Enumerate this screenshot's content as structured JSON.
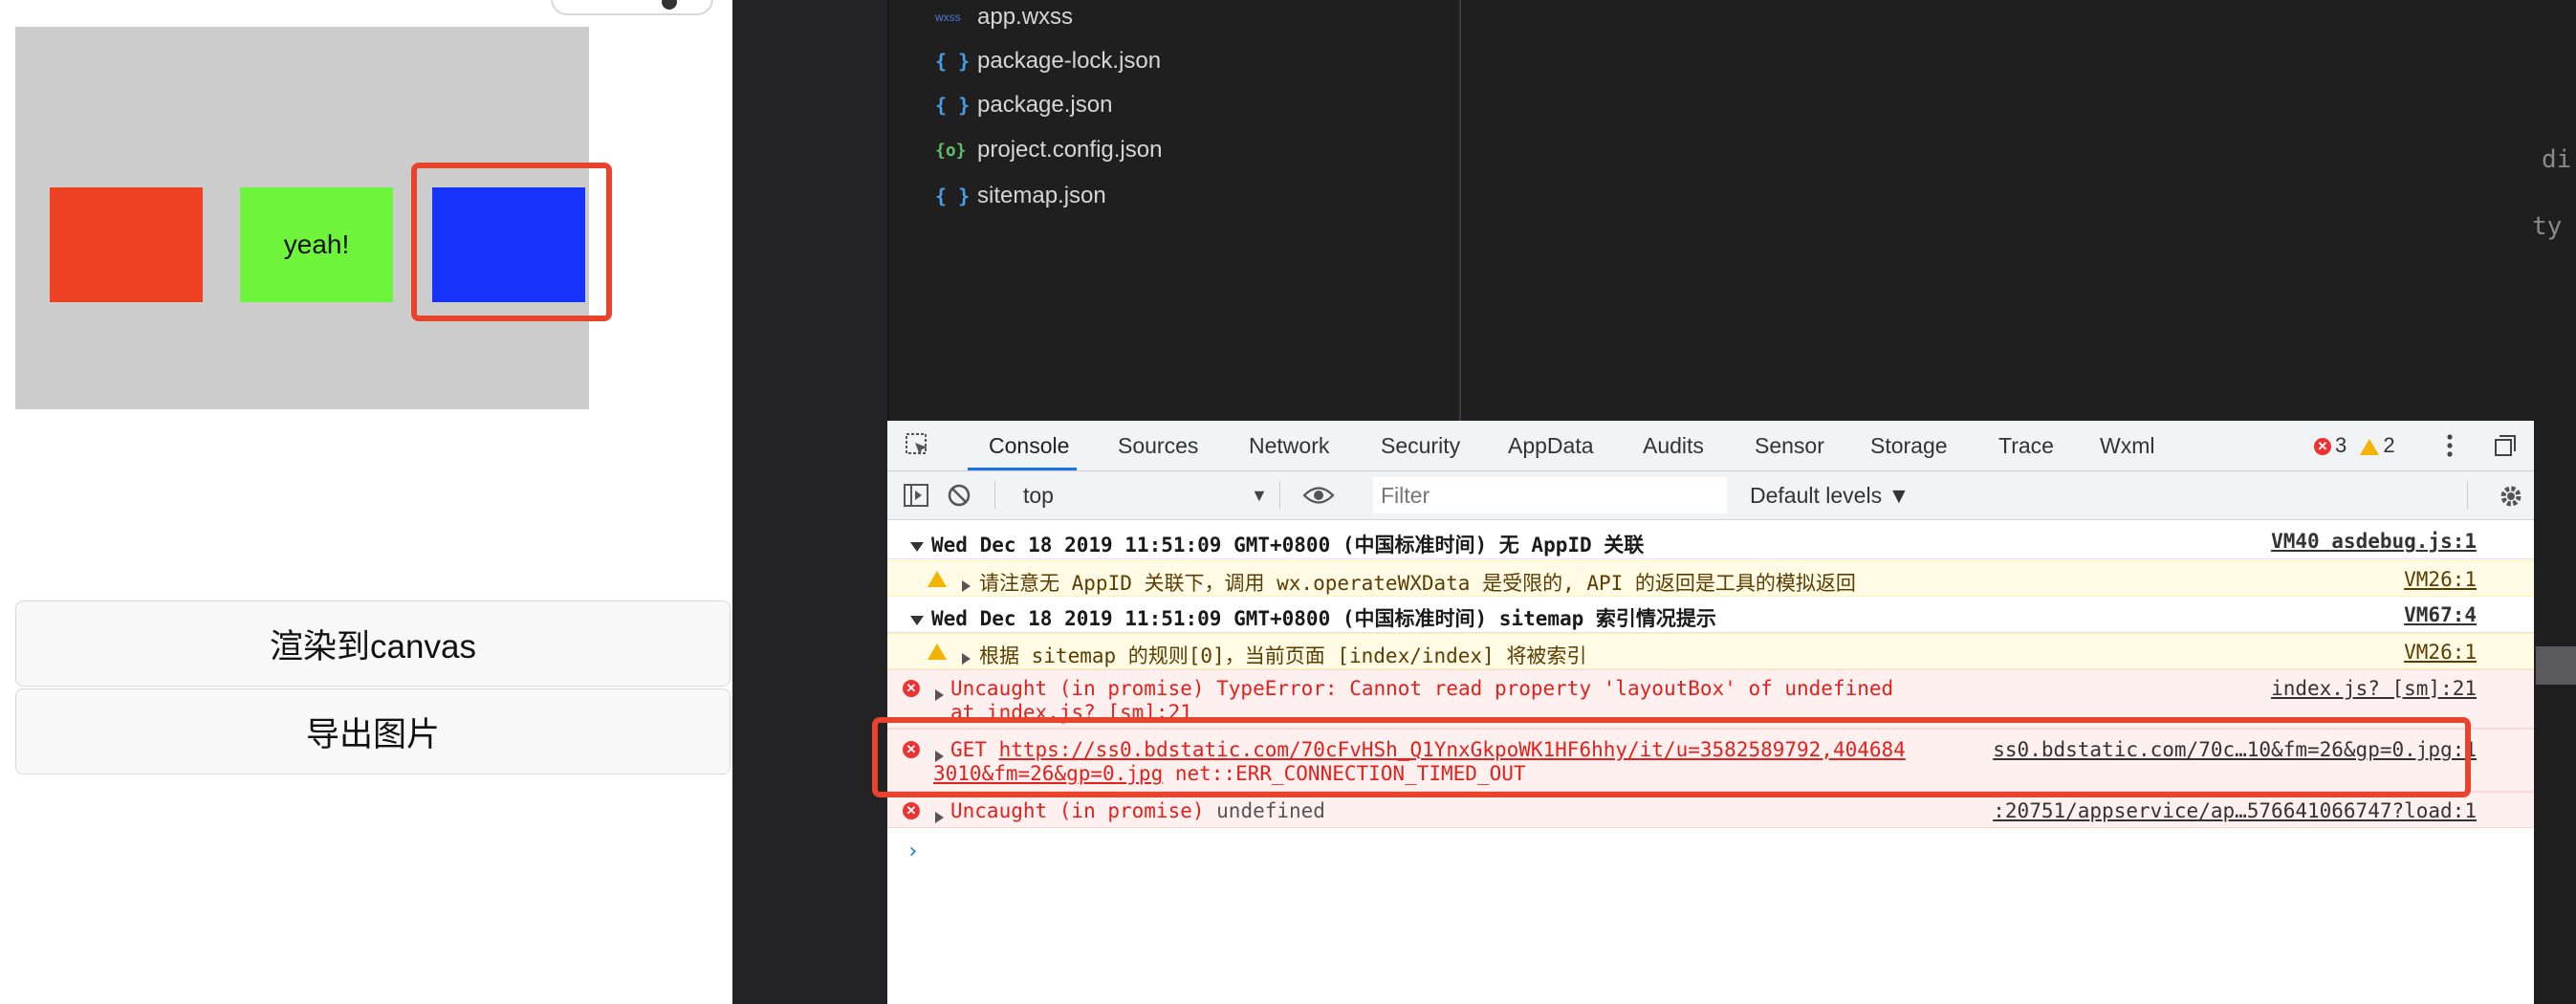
{
  "simulator": {
    "green_rect_label": "yeah!",
    "render_button": "渲染到canvas",
    "export_button": "导出图片"
  },
  "file_tree": [
    {
      "name": "app.wxss",
      "icon": "wxss"
    },
    {
      "name": "package-lock.json",
      "icon": "{ }"
    },
    {
      "name": "package.json",
      "icon": "{ }"
    },
    {
      "name": "project.config.json",
      "icon": "{o}"
    },
    {
      "name": "sitemap.json",
      "icon": "{ }"
    }
  ],
  "editor_fragments": [
    "di",
    "ty"
  ],
  "devtools": {
    "tabs": [
      "Console",
      "Sources",
      "Network",
      "Security",
      "AppData",
      "Audits",
      "Sensor",
      "Storage",
      "Trace",
      "Wxml"
    ],
    "active_tab": "Console",
    "error_count": "3",
    "warning_count": "2",
    "context": "top",
    "filter_placeholder": "Filter",
    "levels_label": "Default levels ▼"
  },
  "console_messages": {
    "m1_text": "Wed Dec 18 2019 11:51:09 GMT+0800 (中国标准时间) 无 AppID 关联",
    "m1_src": "VM40 asdebug.js:1",
    "m2_text": "请注意无 AppID 关联下，调用 wx.operateWXData 是受限的, API 的返回是工具的模拟返回",
    "m2_src": "VM26:1",
    "m3_text": "Wed Dec 18 2019 11:51:09 GMT+0800 (中国标准时间) sitemap 索引情况提示",
    "m3_src": "VM67:4",
    "m4_text": " 根据 sitemap 的规则[0]，当前页面 [index/index] 将被索引",
    "m4_src": "VM26:1",
    "m5_text": "Uncaught (in promise) TypeError: Cannot read property 'layoutBox' of undefined",
    "m5_line2": "    at index.js? [sm]:21",
    "m5_src": "index.js? [sm]:21",
    "m6_method": "GET ",
    "m6_url": "https://ss0.bdstatic.com/70cFvHSh_Q1YnxGkpoWK1HF6hhy/it/u=3582589792,404684",
    "m6_url_cont": "3010&fm=26&gp=0.jpg",
    "m6_error": " net::ERR_CONNECTION_TIMED_OUT",
    "m6_src": "ss0.bdstatic.com/70c…10&fm=26&gp=0.jpg:1",
    "m7_text": "Uncaught (in promise) ",
    "m7_value": "undefined",
    "m7_src": ":20751/appservice/ap…576641066747?load:1"
  },
  "colors": {
    "accent_blue": "#1a73e8",
    "error_red": "#e2211c",
    "highlight_red": "#e8432d",
    "rect_red": "#ee4124",
    "rect_green": "#6ef43a",
    "rect_blue": "#1632fb"
  }
}
